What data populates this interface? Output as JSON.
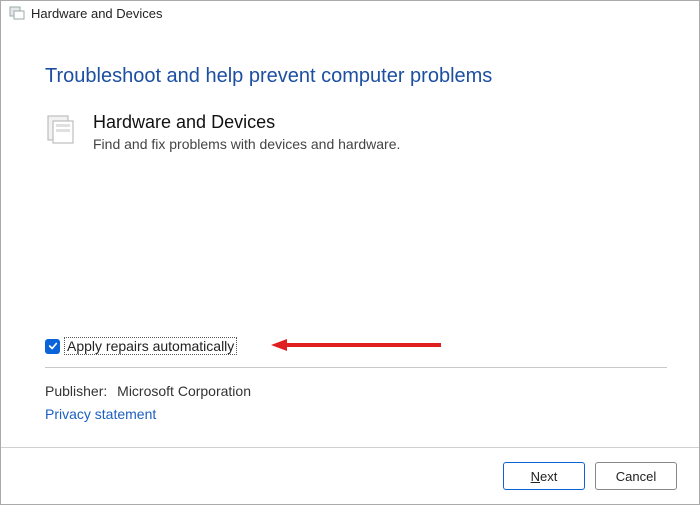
{
  "titlebar": {
    "title": "Hardware and Devices"
  },
  "heading": "Troubleshoot and help prevent computer problems",
  "item": {
    "title": "Hardware and Devices",
    "description": "Find and fix problems with devices and hardware."
  },
  "options": {
    "apply_repairs_label": "Apply repairs automatically",
    "apply_repairs_checked": true
  },
  "publisher": {
    "label": "Publisher:",
    "value": "Microsoft Corporation"
  },
  "privacy_link": "Privacy statement",
  "buttons": {
    "next": "Next",
    "cancel": "Cancel"
  }
}
